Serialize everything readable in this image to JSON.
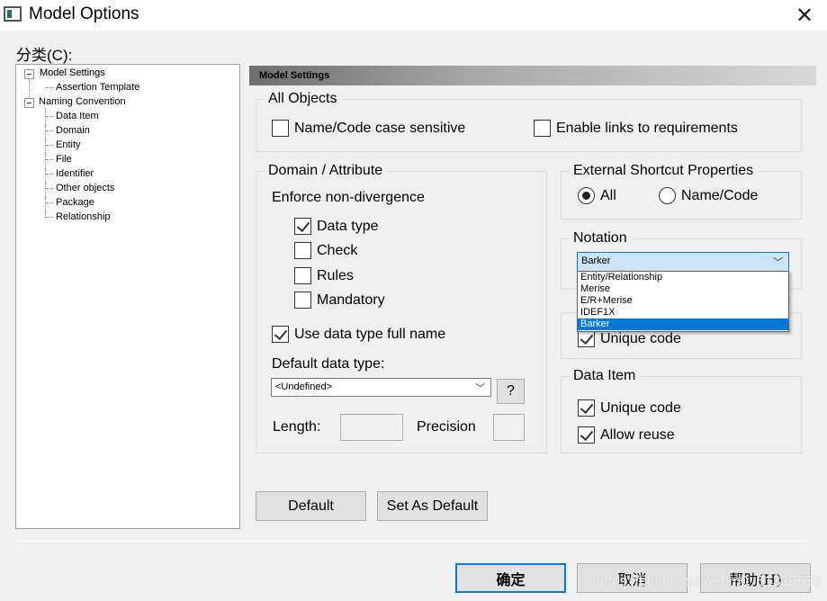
{
  "window": {
    "title": "Model Options",
    "close_icon": "close-icon"
  },
  "category_label": "分类(C):",
  "tree": [
    {
      "label": "Model Settings",
      "level": 0,
      "selected": true
    },
    {
      "label": "Assertion Template",
      "level": 1
    },
    {
      "label": "Naming Convention",
      "level": 0
    },
    {
      "label": "Data Item",
      "level": 1
    },
    {
      "label": "Domain",
      "level": 1
    },
    {
      "label": "Entity",
      "level": 1
    },
    {
      "label": "File",
      "level": 1
    },
    {
      "label": "Identifier",
      "level": 1
    },
    {
      "label": "Other objects",
      "level": 1
    },
    {
      "label": "Package",
      "level": 1
    },
    {
      "label": "Relationship",
      "level": 1
    }
  ],
  "panel_header": "Model Settings",
  "all_objects": {
    "title": "All Objects",
    "name_code_case": {
      "label": "Name/Code case sensitive",
      "checked": false
    },
    "enable_links": {
      "label": "Enable links to requirements",
      "checked": false
    }
  },
  "domain_attribute": {
    "title": "Domain / Attribute",
    "enforce_label": "Enforce non-divergence",
    "items": [
      {
        "label": "Data type",
        "checked": true
      },
      {
        "label": "Check",
        "checked": false
      },
      {
        "label": "Rules",
        "checked": false
      },
      {
        "label": "Mandatory",
        "checked": false
      }
    ],
    "use_full_name": {
      "label": "Use data type full name",
      "checked": true
    },
    "default_type_label": "Default data type:",
    "default_type_value": "<Undefined>",
    "help_button": "?",
    "length_label": "Length:",
    "length_value": "",
    "precision_label": "Precision",
    "precision_value": ""
  },
  "external_shortcut": {
    "title": "External Shortcut Properties",
    "options": [
      {
        "label": "All",
        "selected": true
      },
      {
        "label": "Name/Code",
        "selected": false
      }
    ]
  },
  "notation": {
    "title": "Notation",
    "value": "Barker",
    "options": [
      "Entity/Relationship",
      "Merise",
      "E/R+Merise",
      "IDEF1X",
      "Barker"
    ]
  },
  "relationship_group": {
    "unique_code": {
      "label": "Unique code",
      "checked": true
    }
  },
  "data_item": {
    "title": "Data Item",
    "unique_code": {
      "label": "Unique code",
      "checked": true
    },
    "allow_reuse": {
      "label": "Allow reuse",
      "checked": true
    }
  },
  "buttons": {
    "default": "Default",
    "set_as_default": "Set As Default",
    "ok": "确定",
    "cancel": "取消",
    "help": "帮助(H)"
  },
  "watermark": "https://blog.csdn.net/m0_51329556",
  "colors": {
    "accent": "#0078d7",
    "selected_combo": "#cce4f7"
  }
}
